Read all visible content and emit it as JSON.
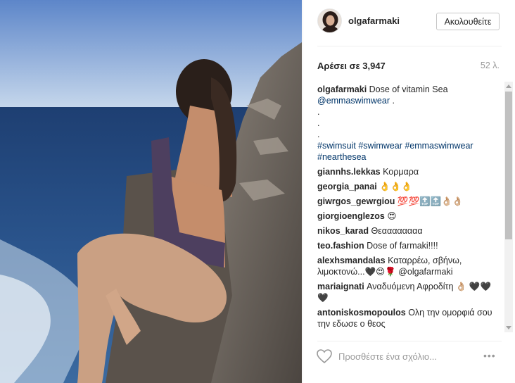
{
  "post": {
    "username": "olgafarmaki",
    "follow_label": "Ακολουθείτε",
    "likes": "Αρέσει σε 3,947",
    "time_ago": "52 λ.",
    "caption": {
      "user": "olgafarmaki",
      "text": "Dose of vitamin Sea",
      "mention": "@emmaswimwear",
      "after_mention": " .\n.\n.\n.",
      "tags": "#swimsuit #swimwear #emmaswimwear #nearthesea"
    },
    "comments": [
      {
        "user": "giannhs.lekkas",
        "text": "Κορμαρα"
      },
      {
        "user": "georgia_panai",
        "text": "👌👌👌"
      },
      {
        "user": "giwrgos_gewrgiou",
        "text": "💯💯🔝🔝👌🏼👌🏼"
      },
      {
        "user": "giorgioenglezos",
        "text": "😍"
      },
      {
        "user": "nikos_karad",
        "text": "Θεαααααααα"
      },
      {
        "user": "teo.fashion",
        "text": "Dose of farmaki!!!!"
      },
      {
        "user": "alexhsmandalas",
        "text": "Καταρρέω, σβήνω, λιμοκτονώ...🖤😍🌹 @olgafarmaki"
      },
      {
        "user": "mariaignati",
        "text": "Αναδυόμενη Αφροδίτη 👌🏼 🖤🖤🖤"
      },
      {
        "user": "antoniskosmopoulos",
        "text": "Ολη την ομορφιά σου την εδωσε ο θεος"
      }
    ],
    "comment_placeholder": "Προσθέστε ένα σχόλιο...",
    "more_label": "•••"
  }
}
